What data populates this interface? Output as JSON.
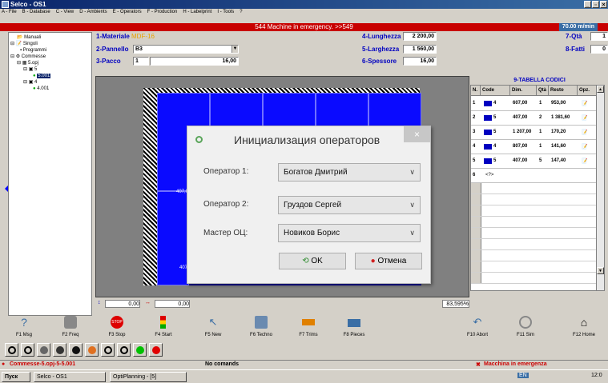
{
  "window": {
    "title": "Selco - OS1"
  },
  "menu": [
    {
      "label": "A - File"
    },
    {
      "label": "B - Database"
    },
    {
      "label": "C - View"
    },
    {
      "label": "D - Ambients"
    },
    {
      "label": "E - Operators"
    },
    {
      "label": "F - Production"
    },
    {
      "label": "H - Labelprint"
    },
    {
      "label": "I - Tools"
    },
    {
      "label": "?"
    }
  ],
  "alarm": {
    "text": "544 Machine in emergency. >>549",
    "speed": "70.00 m/min"
  },
  "tree": {
    "manuali": "Manuali",
    "singoli": "Singoli",
    "programmi": "Programmi",
    "commesse": "Commesse",
    "commessa": "5.opj",
    "n5": "5",
    "item_sel": "5.001",
    "n4": "4",
    "item4": "4.001"
  },
  "form": {
    "materiale_label": "1-Materiale",
    "materiale_value": "MDF-16",
    "pannello_label": "2-Pannello",
    "pannello_value": "B3",
    "pacco_label": "3-Pacco",
    "pacco_value": "1",
    "pacco_extra": "16,00",
    "lunghezza_label": "4-Lunghezza",
    "lunghezza_value": "2 200,00",
    "larghezza_label": "5-Larghezza",
    "larghezza_value": "1 560,00",
    "spessore_label": "6-Spessore",
    "spessore_value": "16,00",
    "qta_label": "7-Qtà",
    "qta_value": "1",
    "fatti_label": "8-Fatti",
    "fatti_value": "0"
  },
  "canvas": {
    "piece_label1": "407,0",
    "piece_label2": "407"
  },
  "dialog": {
    "title": "Инициализация операторов",
    "op1_label": "Оператор 1:",
    "op1_value": "Богатов Дмитрий",
    "op2_label": "Оператор 2:",
    "op2_value": "Груздов Сергей",
    "master_label": "Мастер ОЦ:",
    "master_value": "Новиков Борис",
    "ok": "OK",
    "cancel": "Отмена"
  },
  "table": {
    "title": "9-TABELLA CODICI",
    "headers": [
      "N.",
      "Code",
      "Dim.",
      "Qtà",
      "Resto",
      "Opz."
    ],
    "rows": [
      {
        "n": "1",
        "code": "4",
        "dim": "607,00",
        "qta": "1",
        "resto": "953,00"
      },
      {
        "n": "2",
        "code": "5",
        "dim": "407,00",
        "qta": "2",
        "resto": "1 381,60"
      },
      {
        "n": "3",
        "code": "5",
        "dim": "1 207,00",
        "qta": "1",
        "resto": "170,20"
      },
      {
        "n": "4",
        "code": "4",
        "dim": "807,00",
        "qta": "1",
        "resto": "141,60"
      },
      {
        "n": "5",
        "code": "5",
        "dim": "407,00",
        "qta": "5",
        "resto": "147,40"
      },
      {
        "n": "6",
        "code": "<?>",
        "dim": "",
        "qta": "",
        "resto": ""
      }
    ]
  },
  "status": {
    "x": "0,00",
    "y": "0,00",
    "zoom": "83,595%"
  },
  "fnkeys": [
    {
      "label": "F1 Msg"
    },
    {
      "label": "F2 Freq"
    },
    {
      "label": "F3 Stop"
    },
    {
      "label": "F4 Start"
    },
    {
      "label": "F5 New"
    },
    {
      "label": "F6 Techno"
    },
    {
      "label": "F7 Trims"
    },
    {
      "label": "F8 Pieces"
    },
    {
      "label": "F10 Abort"
    },
    {
      "label": "F11 Sim"
    },
    {
      "label": "F12 Home"
    }
  ],
  "bottom": {
    "path": "Commesse-5.opj-5-5.001",
    "commands": "No comands",
    "emergency": "Macchina in emergenza"
  },
  "taskbar": {
    "start": "Пуск",
    "app1": "Selco - OS1",
    "app2": "OptiPlanning - [5]",
    "lang": "EN",
    "time": "12:0"
  }
}
